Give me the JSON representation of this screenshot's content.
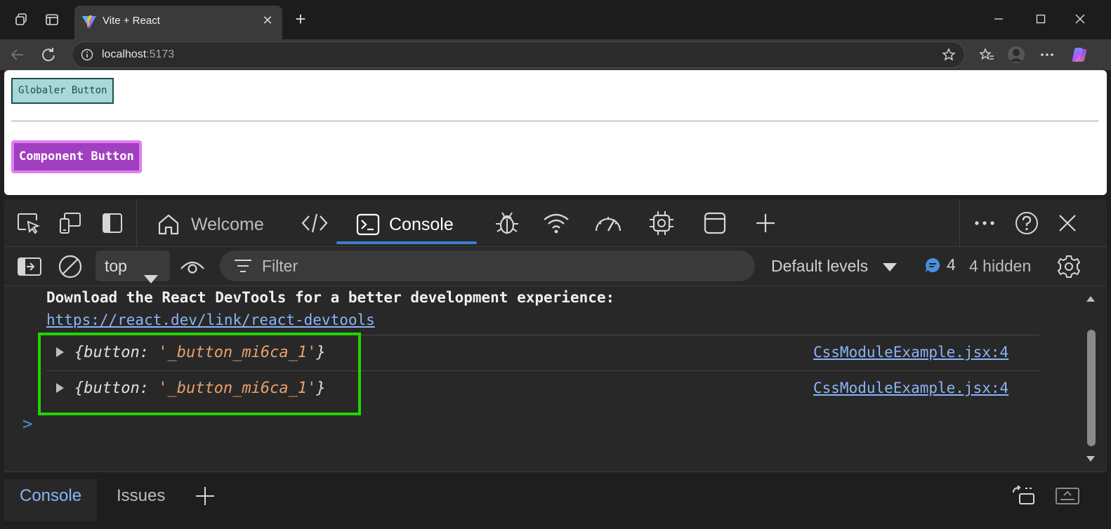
{
  "browser": {
    "tab_title": "Vite + React",
    "url_host": "localhost",
    "url_port": ":5173"
  },
  "page": {
    "global_button_label": "Globaler Button",
    "component_button_label": "Component Button"
  },
  "devtools": {
    "tabs": [
      {
        "label": "Welcome"
      },
      {
        "label": "Console"
      }
    ],
    "context_selector": "top",
    "filter_placeholder": "Filter",
    "levels_label": "Default levels",
    "message_count": "4",
    "hidden_label": "4 hidden",
    "console": {
      "message": "Download the React DevTools for a better development experience:",
      "message_link": "https://react.dev/link/react-devtools",
      "logs": [
        {
          "key": "{button: ",
          "value": "'_button_mi6ca_1'",
          "close": "}",
          "source": "CssModuleExample.jsx:4"
        },
        {
          "key": "{button: ",
          "value": "'_button_mi6ca_1'",
          "close": "}",
          "source": "CssModuleExample.jsx:4"
        }
      ],
      "prompt": ">"
    },
    "drawer_tabs": [
      {
        "label": "Console"
      },
      {
        "label": "Issues"
      }
    ]
  },
  "colors": {
    "accent": "#3c7fd1",
    "highlight": "#22d400",
    "link": "#8ab4f8"
  }
}
